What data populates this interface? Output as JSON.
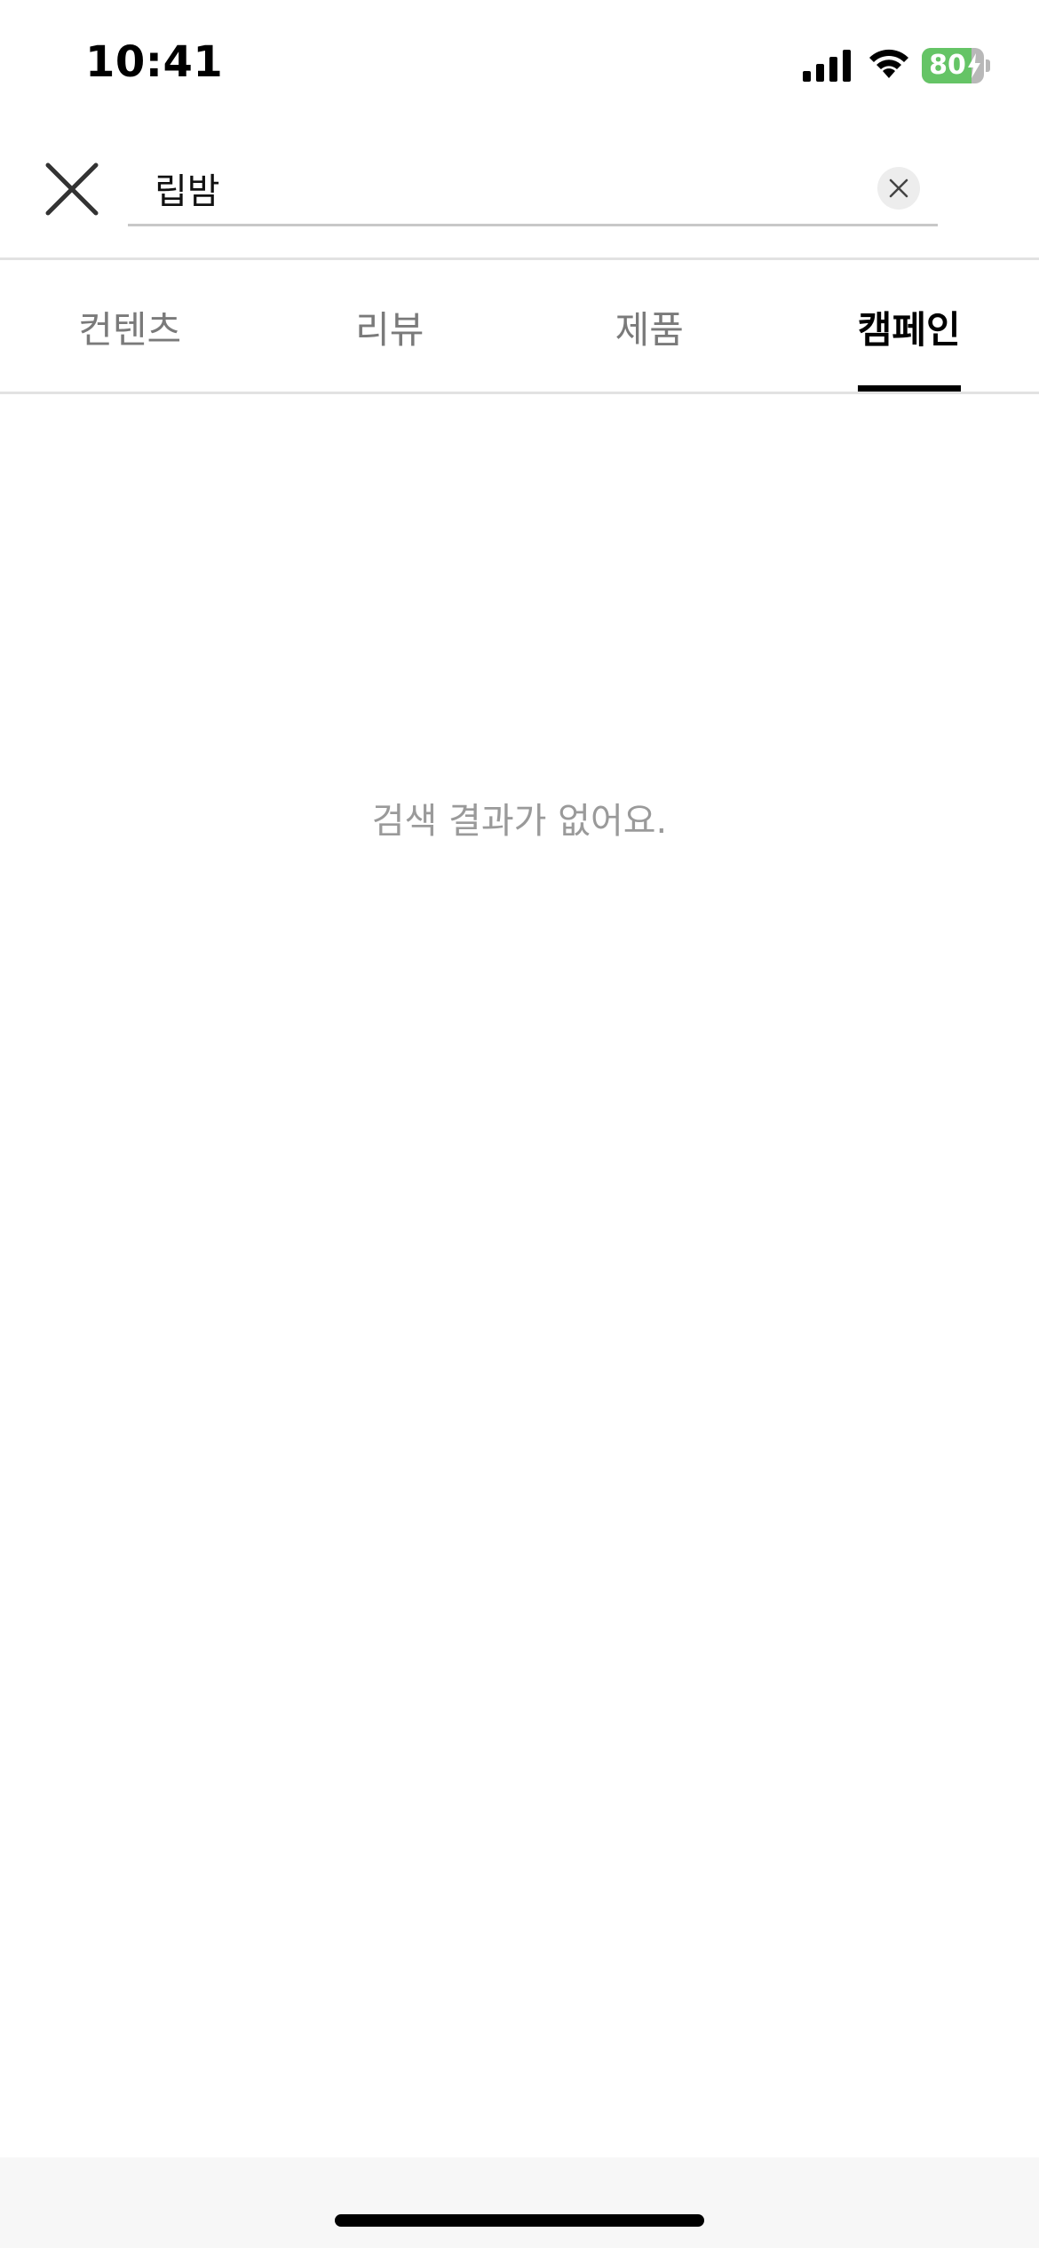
{
  "status_bar": {
    "time": "10:41",
    "battery_level": "80",
    "battery_percent": 80,
    "charging": true,
    "battery_color": "#65c466"
  },
  "search": {
    "query": "립밤",
    "close_icon": "close-icon",
    "clear_icon": "clear-icon"
  },
  "tabs": [
    {
      "label": "컨텐츠",
      "active": false
    },
    {
      "label": "리뷰",
      "active": false
    },
    {
      "label": "제품",
      "active": false
    },
    {
      "label": "캠페인",
      "active": true
    }
  ],
  "content": {
    "empty_message": "검색 결과가 없어요."
  }
}
